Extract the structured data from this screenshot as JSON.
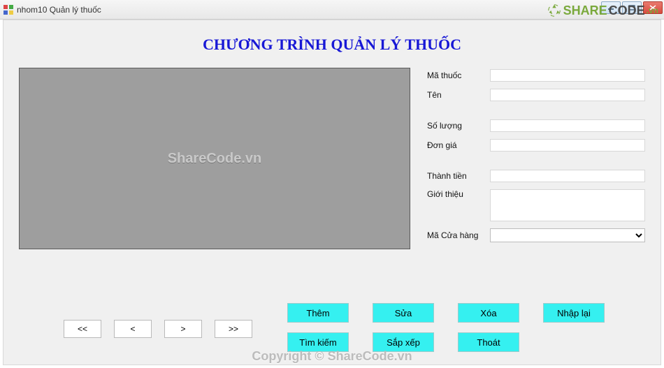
{
  "window": {
    "title": "nhom10 Quản lý thuốc"
  },
  "heading": {
    "text": "CHƯƠNG TRÌNH QUẢN LÝ THUỐC",
    "color": "#1818d6"
  },
  "grid": {
    "watermark": "ShareCode.vn"
  },
  "form": {
    "ma_thuoc": {
      "label": "Mã thuốc",
      "value": ""
    },
    "ten": {
      "label": "Tên",
      "value": ""
    },
    "so_luong": {
      "label": "Số lượng",
      "value": ""
    },
    "don_gia": {
      "label": "Đơn giá",
      "value": ""
    },
    "thanh_tien": {
      "label": "Thành tiền",
      "value": ""
    },
    "gioi_thieu": {
      "label": "Giới thiệu",
      "value": ""
    },
    "ma_cua_hang": {
      "label": "Mã Cửa hàng",
      "selected": ""
    }
  },
  "nav": {
    "first": "<<",
    "prev": "<",
    "next": ">",
    "last": ">>"
  },
  "actions": {
    "them": "Thêm",
    "sua": "Sửa",
    "xoa": "Xóa",
    "nhap_lai": "Nhập lại",
    "tim_kiem": "Tìm kiếm",
    "sap_xep": "Sắp xếp",
    "thoat": "Thoát",
    "bg": "#35f0f0"
  },
  "overlay": {
    "logo_share": "SHARE",
    "logo_code": "CODE",
    "logo_ext": ".vn",
    "copyright": "Copyright © ShareCode.vn"
  }
}
